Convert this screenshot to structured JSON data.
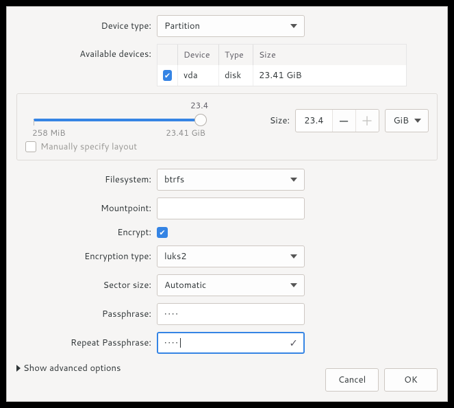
{
  "labels": {
    "device_type": "Device type:",
    "available_devices": "Available devices:",
    "size": "Size:",
    "manual_layout": "Manually specify layout",
    "filesystem": "Filesystem:",
    "mountpoint": "Mountpoint:",
    "encrypt": "Encrypt:",
    "encryption_type": "Encryption type:",
    "sector_size": "Sector size:",
    "passphrase": "Passphrase:",
    "repeat_passphrase": "Repeat Passphrase:",
    "show_advanced": "Show advanced options"
  },
  "device_type": {
    "selected": "Partition"
  },
  "devices": {
    "headers": {
      "device": "Device",
      "type": "Type",
      "size": "Size"
    },
    "rows": [
      {
        "checked": true,
        "device": "vda",
        "type": "disk",
        "size": "23.41 GiB"
      }
    ]
  },
  "size": {
    "tooltip_value": "23.4",
    "value": "23.4",
    "min_label": "258 MiB",
    "max_label": "23.41 GiB",
    "unit": "GiB",
    "manual_layout_checked": false
  },
  "filesystem": {
    "selected": "btrfs"
  },
  "mountpoint": {
    "value": ""
  },
  "encrypt": {
    "checked": true
  },
  "encryption_type": {
    "selected": "luks2"
  },
  "sector_size": {
    "selected": "Automatic"
  },
  "passphrase": {
    "value": "••••"
  },
  "repeat_passphrase": {
    "value": "••••",
    "match": true
  },
  "footer": {
    "cancel": "Cancel",
    "ok": "OK"
  }
}
